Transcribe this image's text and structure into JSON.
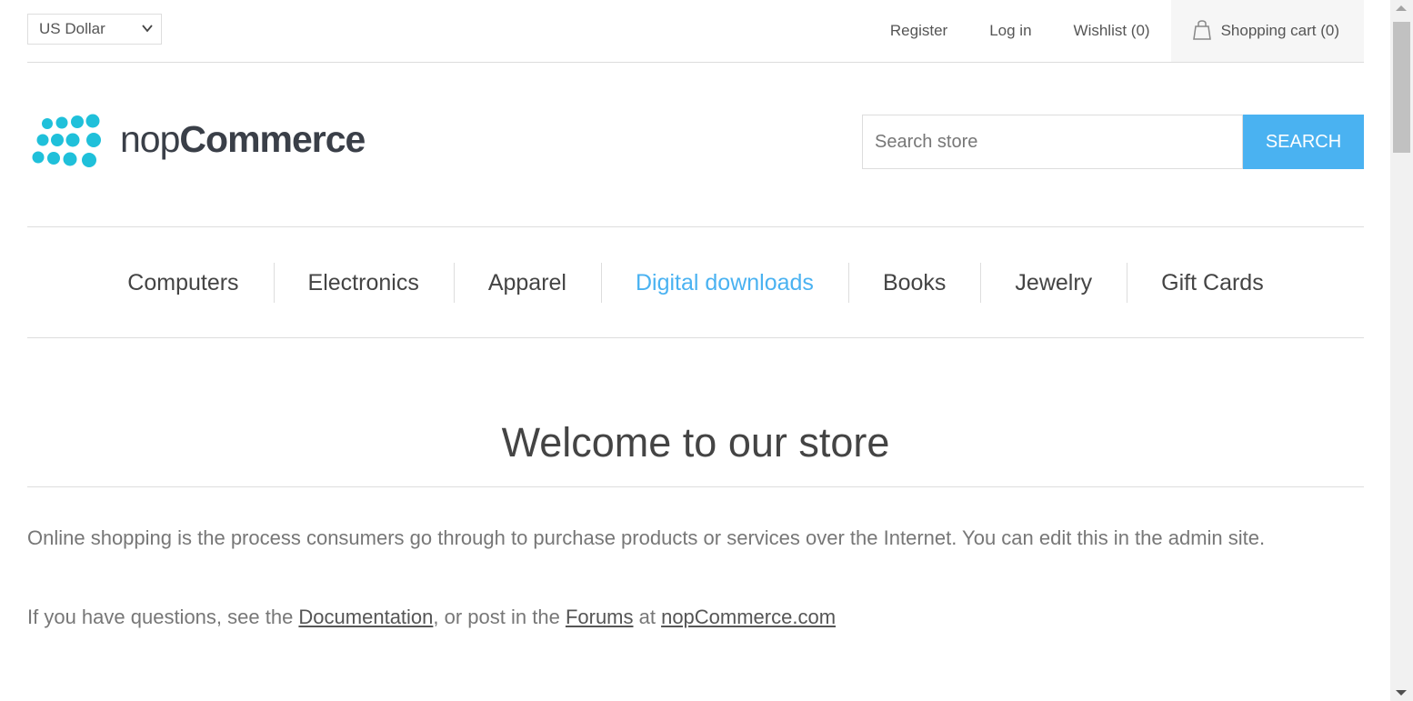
{
  "header": {
    "currency_selected": "US Dollar",
    "links": {
      "register": "Register",
      "login": "Log in",
      "wishlist": "Wishlist (0)",
      "cart": "Shopping cart (0)"
    }
  },
  "logo": {
    "text_light": "nop",
    "text_bold": "Commerce",
    "dot_color": "#1fc0da"
  },
  "search": {
    "placeholder": "Search store",
    "button_label": "SEARCH"
  },
  "menu": {
    "items": [
      {
        "label": "Computers",
        "active": false
      },
      {
        "label": "Electronics",
        "active": false
      },
      {
        "label": "Apparel",
        "active": false
      },
      {
        "label": "Digital downloads",
        "active": true
      },
      {
        "label": "Books",
        "active": false
      },
      {
        "label": "Jewelry",
        "active": false
      },
      {
        "label": "Gift Cards",
        "active": false
      }
    ],
    "active_color": "#4ab2f1"
  },
  "content": {
    "title": "Welcome to our store",
    "paragraph1": "Online shopping is the process consumers go through to purchase products or services over the Internet. You can edit this in the admin site.",
    "paragraph2": {
      "prefix": "If you have questions, see the ",
      "doc_link": "Documentation",
      "middle": ", or post in the ",
      "forums_link": "Forums",
      "at": " at ",
      "site_link": "nopCommerce.com"
    }
  },
  "colors": {
    "accent": "#4ab2f1",
    "text": "#444444",
    "muted": "#777777"
  }
}
